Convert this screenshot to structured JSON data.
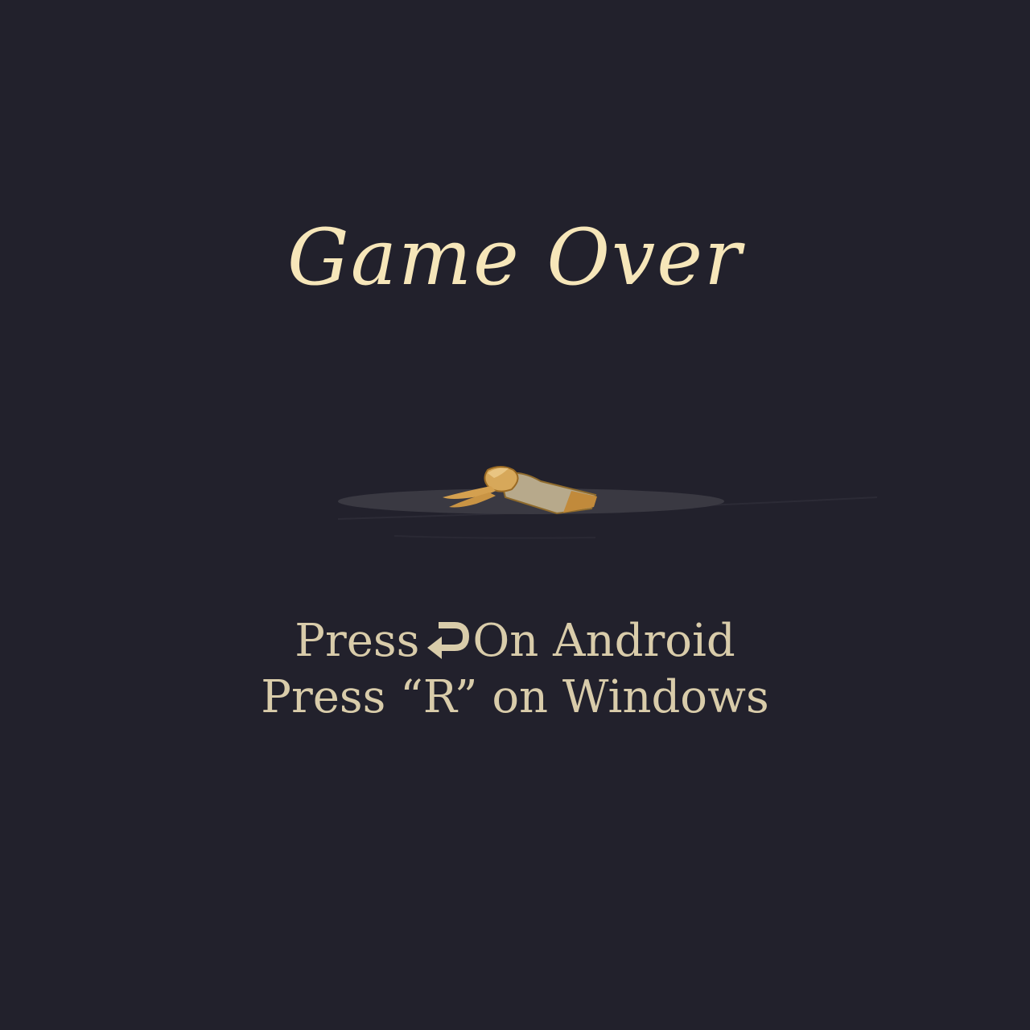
{
  "screen": {
    "title": "Game Over",
    "instructions": {
      "android": {
        "prefix": "Press",
        "icon": "back-arrow-icon",
        "suffix": "On Android"
      },
      "windows": "Press “R” on Windows"
    },
    "character": "fallen-character-sprite"
  },
  "colors": {
    "background": "#22212c",
    "title": "#f6e6b9",
    "text": "#d9ccaa",
    "shadow": "#3a3942"
  }
}
